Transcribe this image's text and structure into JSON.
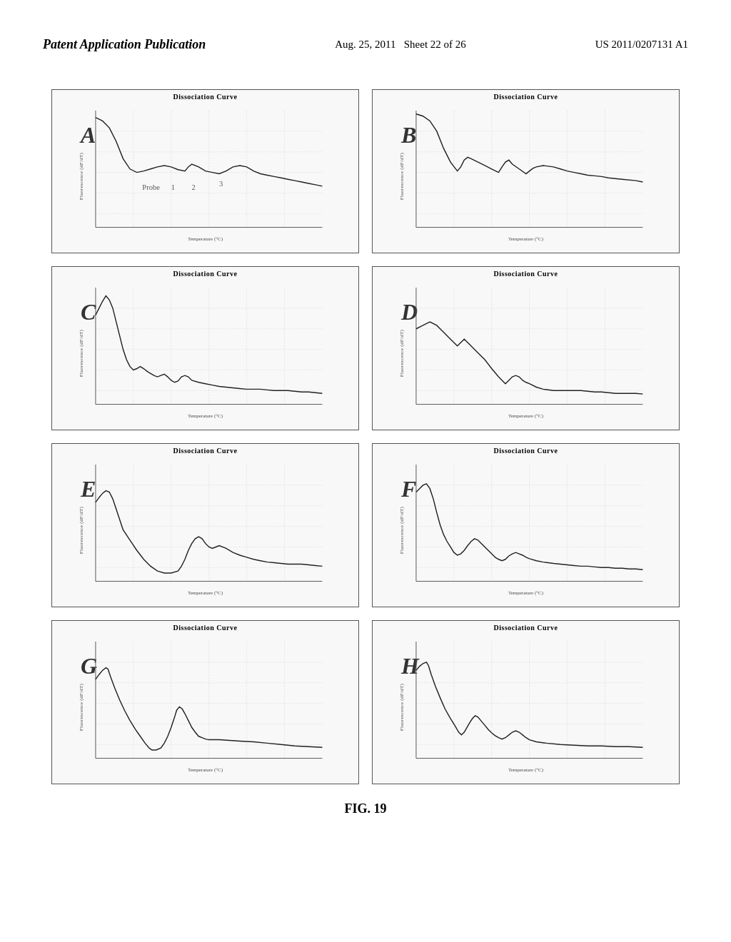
{
  "header": {
    "left_label": "Patent Application Publication",
    "center_date": "Aug. 25, 2011",
    "center_sheet": "Sheet 22 of 26",
    "right_patent": "US 2011/0207131 A1"
  },
  "figure": {
    "caption": "FIG. 19",
    "charts": [
      {
        "id": "A",
        "title": "Dissociation Curve",
        "y_label": "Fluorescence (dF/dT)",
        "x_label": "Temperature (°C)",
        "probe_labels": [
          "Probe",
          "1",
          "2",
          "3"
        ]
      },
      {
        "id": "B",
        "title": "Dissociation Curve",
        "y_label": "Fluorescence (dF/dT)",
        "x_label": "Temperature (°C)"
      },
      {
        "id": "C",
        "title": "Dissociation Curve",
        "y_label": "Fluorescence (dF/dT)",
        "x_label": "Temperature (°C)"
      },
      {
        "id": "D",
        "title": "Dissociation Curve",
        "y_label": "Fluorescence (dF/dT)",
        "x_label": "Temperature (°C)"
      },
      {
        "id": "E",
        "title": "Dissociation Curve",
        "y_label": "Fluorescence (dF/dT)",
        "x_label": "Temperature (°C)"
      },
      {
        "id": "F",
        "title": "Dissociation Curve",
        "y_label": "Fluorescence (dF/dT)",
        "x_label": "Temperature (°C)"
      },
      {
        "id": "G",
        "title": "Dissociation Curve",
        "y_label": "Fluorescence (dF/dT)",
        "x_label": "Temperature (°C)"
      },
      {
        "id": "H",
        "title": "Dissociation Curve",
        "y_label": "Fluorescence (dF/dT)",
        "x_label": "Temperature (°C)"
      }
    ]
  }
}
